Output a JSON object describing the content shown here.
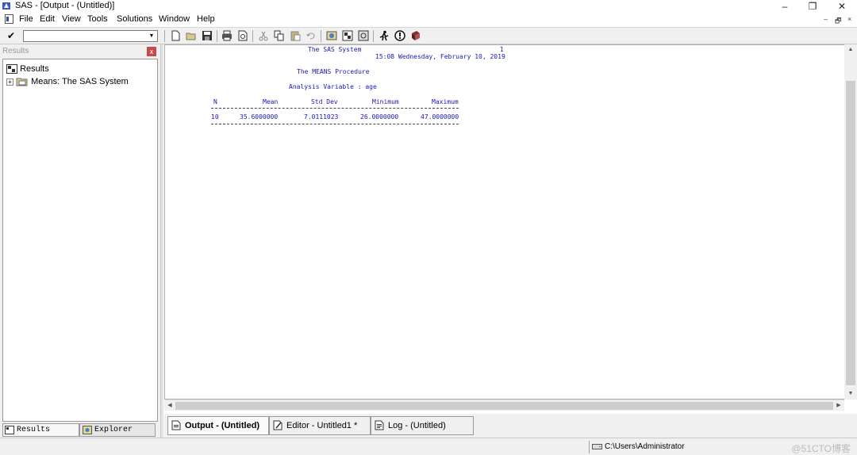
{
  "window": {
    "title": "SAS - [Output - (Untitled)]",
    "minimize_glyph": "–",
    "restore_glyph": "❐",
    "close_glyph": "✕"
  },
  "menu": {
    "items": [
      "File",
      "Edit",
      "View",
      "Tools",
      "Solutions",
      "Window",
      "Help"
    ],
    "mdi_controls": [
      "–",
      "🗗",
      "×"
    ]
  },
  "toolbar": {
    "command_value": "",
    "icons": [
      "new-icon",
      "open-icon",
      "save-icon",
      "print-icon",
      "print-preview-icon",
      "cut-icon",
      "copy-icon",
      "paste-icon",
      "undo-icon",
      "explorer-icon",
      "results-icon",
      "output-icon",
      "run-icon",
      "help-icon",
      "sas-docs-icon"
    ]
  },
  "results_pane": {
    "header": "Results",
    "close_glyph": "x",
    "tree": [
      {
        "label": "Results",
        "level": 0
      },
      {
        "label": "Means:  The SAS System",
        "level": 1,
        "expand": "+"
      }
    ],
    "tabs": [
      "Results",
      "Explorer"
    ]
  },
  "output": {
    "system_title": "The SAS System",
    "page_number": "1",
    "timestamp": "15:08 Wednesday, February 10, 2019",
    "procedure": "The MEANS Procedure",
    "analysis_variable": "Analysis Variable : age",
    "table": {
      "headers": [
        "N",
        "Mean",
        "Std Dev",
        "Minimum",
        "Maximum"
      ],
      "rows": [
        [
          "10",
          "35.6000000",
          "7.0111023",
          "26.0000000",
          "47.0000000"
        ]
      ]
    }
  },
  "window_tabs": [
    {
      "label": "Output - (Untitled)",
      "active": true
    },
    {
      "label": "Editor - Untitled1 *",
      "active": false
    },
    {
      "label": "Log - (Untitled)",
      "active": false
    }
  ],
  "status": {
    "path": "C:\\Users\\Administrator",
    "watermark": "@51CTO博客"
  },
  "colors": {
    "output_text": "#1a1ab0",
    "chrome_bg": "#f0f0f0"
  }
}
